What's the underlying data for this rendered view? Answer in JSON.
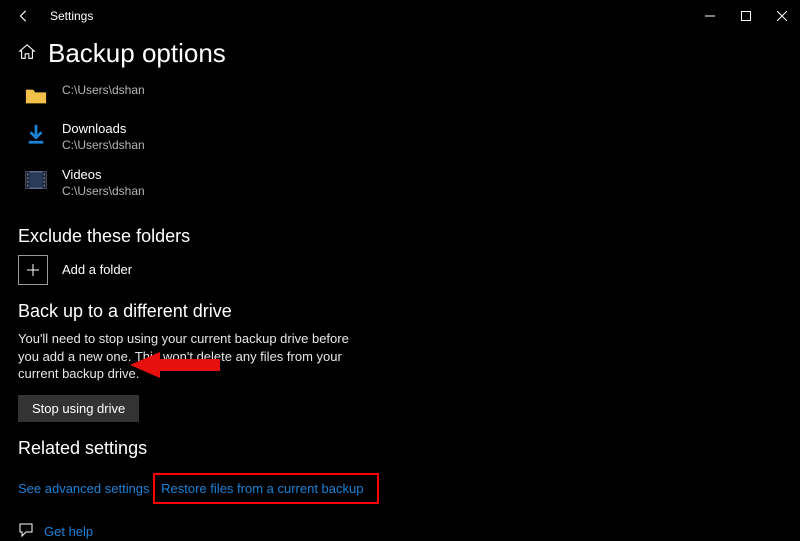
{
  "window": {
    "title": "Settings"
  },
  "page": {
    "title": "Backup options"
  },
  "backup_folders": [
    {
      "name": "",
      "path": "C:\\Users\\dshan",
      "icon": "folder"
    },
    {
      "name": "Downloads",
      "path": "C:\\Users\\dshan",
      "icon": "downloads"
    },
    {
      "name": "Videos",
      "path": "C:\\Users\\dshan",
      "icon": "videos"
    }
  ],
  "exclude": {
    "heading": "Exclude these folders",
    "add_label": "Add a folder"
  },
  "different_drive": {
    "heading": "Back up to a different drive",
    "body": "You'll need to stop using your current backup drive before you add a new one. This won't delete any files from your current backup drive.",
    "button": "Stop using drive"
  },
  "related": {
    "heading": "Related settings",
    "advanced": "See advanced settings",
    "restore": "Restore files from a current backup"
  },
  "help": {
    "label": "Get help"
  }
}
